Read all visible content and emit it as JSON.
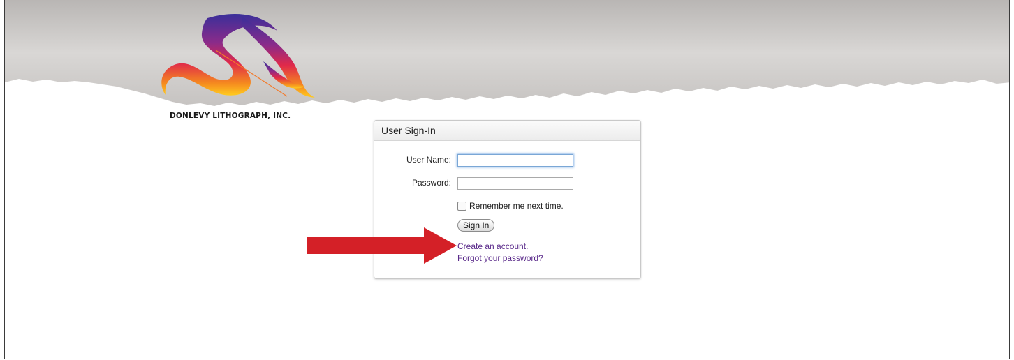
{
  "branding": {
    "company_name": "DONLEVY LITHOGRAPH, INC."
  },
  "signin_panel": {
    "title": "User Sign-In",
    "username_label": "User Name:",
    "username_value": "",
    "password_label": "Password:",
    "password_value": "",
    "remember_label": "Remember me next time.",
    "remember_checked": false,
    "signin_button": "Sign In",
    "create_account_link": "Create an account.",
    "forgot_password_link": "Forgot your password?"
  },
  "colors": {
    "banner_gray": "#c9c6c4",
    "link": "#5a2a8a",
    "arrow": "#d42027",
    "focus_ring": "#8db6e6"
  },
  "icons": [
    "company-logo",
    "red-pointer-arrow"
  ]
}
